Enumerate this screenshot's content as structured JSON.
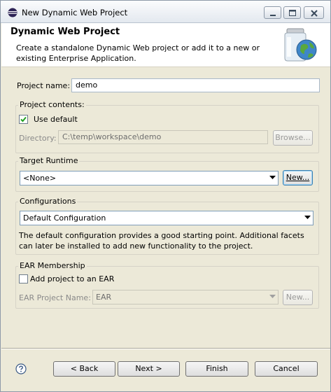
{
  "window": {
    "title": "New Dynamic Web Project"
  },
  "banner": {
    "heading": "Dynamic Web Project",
    "description": "Create a standalone Dynamic Web project or add it to a new or existing Enterprise Application."
  },
  "project_name": {
    "label": "Project name:",
    "value": "demo"
  },
  "project_contents": {
    "title": "Project contents:",
    "use_default_label": "Use default",
    "use_default_checked": true,
    "directory_label": "Directory:",
    "directory_value": "C:\\temp\\workspace\\demo",
    "browse_label": "Browse..."
  },
  "target_runtime": {
    "title": "Target Runtime",
    "selected": "<None>",
    "new_label": "New..."
  },
  "configurations": {
    "title": "Configurations",
    "selected": "Default Configuration",
    "note": "The default configuration provides a good starting point. Additional facets can later be installed to add new functionality to the project."
  },
  "ear_membership": {
    "title": "EAR Membership",
    "add_label": "Add project to an EAR",
    "add_checked": false,
    "project_name_label": "EAR Project Name:",
    "project_name_value": "EAR",
    "new_label": "New..."
  },
  "footer": {
    "back_label": "< Back",
    "next_label": "Next >",
    "finish_label": "Finish",
    "cancel_label": "Cancel"
  },
  "icons": {
    "app": "eclipse-icon",
    "wizard": "web-project-jar-globe-icon",
    "help": "help-icon"
  }
}
